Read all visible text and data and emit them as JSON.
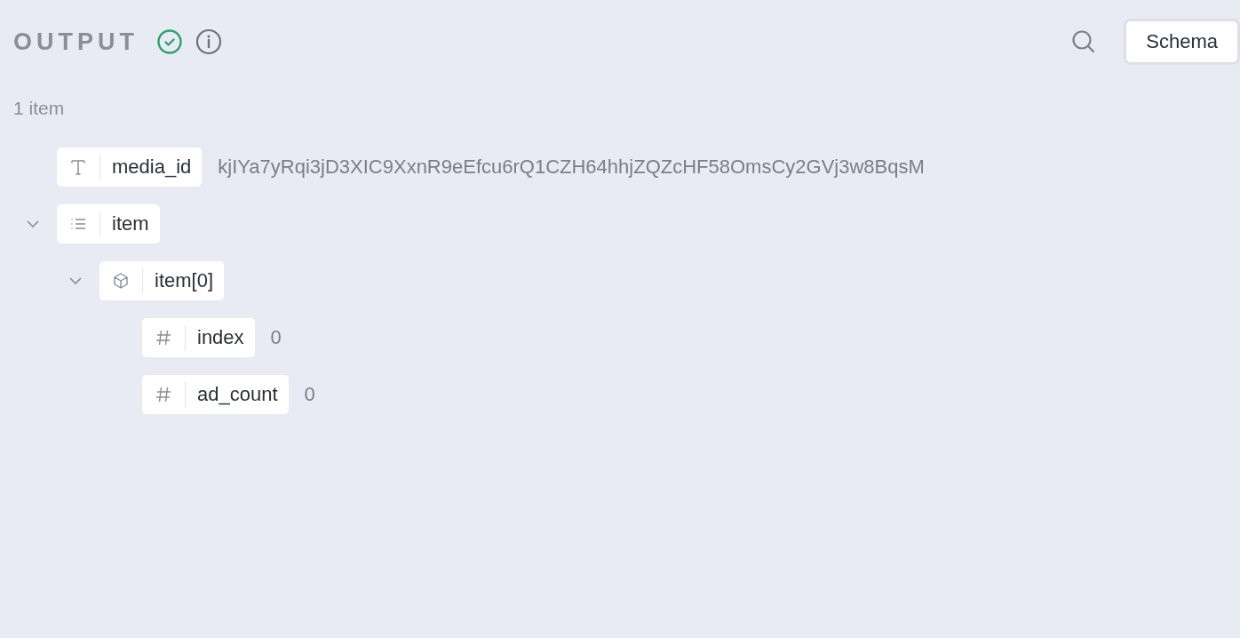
{
  "header": {
    "title": "OUTPUT",
    "schema_button": "Schema"
  },
  "item_count": "1 item",
  "fields": [
    {
      "kind": "string",
      "name": "media_id",
      "value": "kjIYa7yRqi3jD3XIC9XxnR9eEfcu6rQ1CZH64hhjZQZcHF58OmsCy2GVj3w8BqsM"
    },
    {
      "kind": "array",
      "name": "item",
      "expanded": true,
      "children": [
        {
          "kind": "object",
          "name": "item[0]",
          "expanded": true,
          "children": [
            {
              "kind": "number",
              "name": "index",
              "value": "0"
            },
            {
              "kind": "number",
              "name": "ad_count",
              "value": "0"
            }
          ]
        }
      ]
    }
  ]
}
